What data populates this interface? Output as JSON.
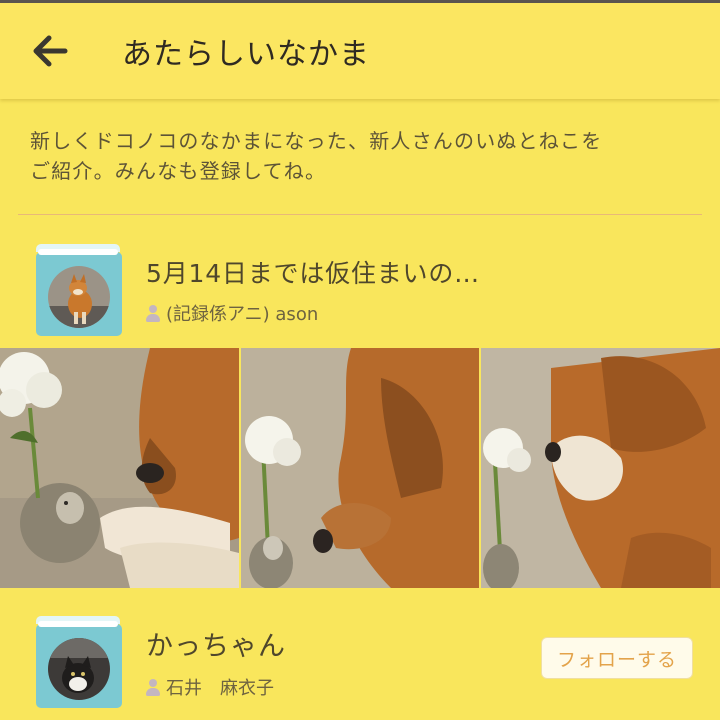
{
  "header": {
    "title": "あたらしいなかま",
    "back_icon": "arrow-left-icon"
  },
  "intro": {
    "line1": "新しくドコノコのなかまになった、新人さんのいぬとねこを",
    "line2": "ご紹介。みんなも登録してね。"
  },
  "post": {
    "title": "5月14日までは仮住まいの…",
    "author": "(記録係アニ) ason"
  },
  "user": {
    "name": "かっちゃん",
    "author": "石井　麻衣子",
    "follow_label": "フォローする"
  },
  "colors": {
    "background": "#f9e65c",
    "book_cover": "#7cc9d2",
    "follow_text": "#e3a34a"
  }
}
